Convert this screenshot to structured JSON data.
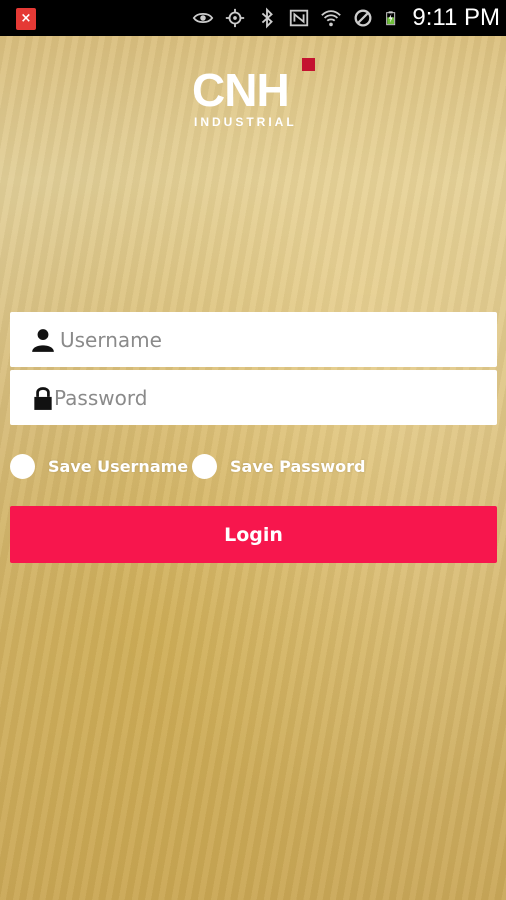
{
  "status_bar": {
    "notification_icon": "app-error-icon",
    "icons": [
      "eye-icon",
      "gps-icon",
      "bluetooth-icon",
      "nfc-icon",
      "wifi-icon",
      "do-not-disturb-icon",
      "battery-charging-icon"
    ],
    "time": "9:11 PM"
  },
  "logo": {
    "main_text": "CNH",
    "sub_text": "INDUSTRIAL",
    "accent_color": "#c41230"
  },
  "login_form": {
    "username_placeholder": "Username",
    "username_value": "",
    "password_placeholder": "Password",
    "password_value": "",
    "save_username_label": "Save Username",
    "save_username_checked": false,
    "save_password_label": "Save Password",
    "save_password_checked": false,
    "login_button_label": "Login",
    "login_button_color": "#f7164d"
  }
}
